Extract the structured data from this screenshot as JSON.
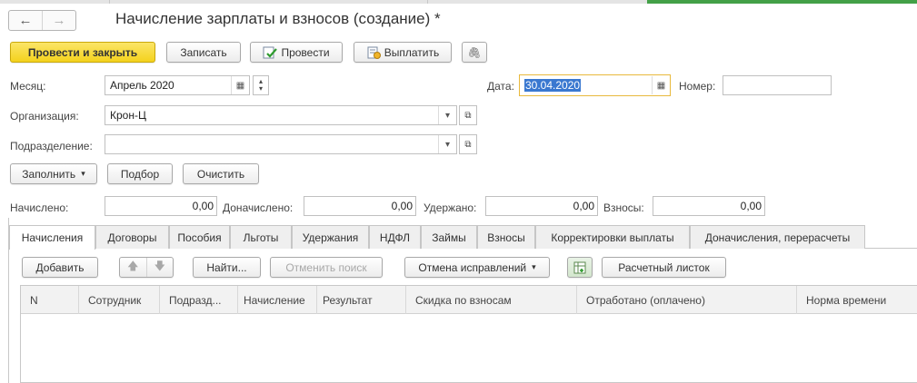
{
  "window": {
    "title": "Начисление зарплаты и взносов (создание) *",
    "back_glyph": "←",
    "forward_glyph": "→"
  },
  "toolbar": {
    "post_close": "Провести и закрыть",
    "save": "Записать",
    "post": "Провести",
    "pay": "Выплатить",
    "attach_glyph": "🖇"
  },
  "fields": {
    "month_label": "Месяц:",
    "month_value": "Апрель 2020",
    "date_label": "Дата:",
    "date_value": "30.04.2020",
    "number_label": "Номер:",
    "number_value": "",
    "org_label": "Организация:",
    "org_value": "Крон-Ц",
    "dept_label": "Подразделение:",
    "dept_value": ""
  },
  "actions": {
    "fill": "Заполнить",
    "select": "Подбор",
    "clear": "Очистить"
  },
  "totals": {
    "accrued_label": "Начислено:",
    "accrued_value": "0,00",
    "extra_label": "Доначислено:",
    "extra_value": "0,00",
    "withheld_label": "Удержано:",
    "withheld_value": "0,00",
    "contrib_label": "Взносы:",
    "contrib_value": "0,00"
  },
  "tabs": [
    "Начисления",
    "Договоры",
    "Пособия",
    "Льготы",
    "Удержания",
    "НДФЛ",
    "Займы",
    "Взносы",
    "Корректировки выплаты",
    "Доначисления, перерасчеты"
  ],
  "table_toolbar": {
    "add": "Добавить",
    "find": "Найти...",
    "cancel_search": "Отменить поиск",
    "undo_corrections": "Отмена исправлений",
    "payslip": "Расчетный листок"
  },
  "columns": [
    "N",
    "Сотрудник",
    "Подразд...",
    "Начисление",
    "Результат",
    "Скидка по взносам",
    "Отработано (оплачено)",
    "Норма времени"
  ],
  "colors": {
    "primary": "#f4d21d",
    "focus_border": "#e8b93d",
    "selection": "#3a78d0",
    "active_window_accent": "#43a047"
  }
}
